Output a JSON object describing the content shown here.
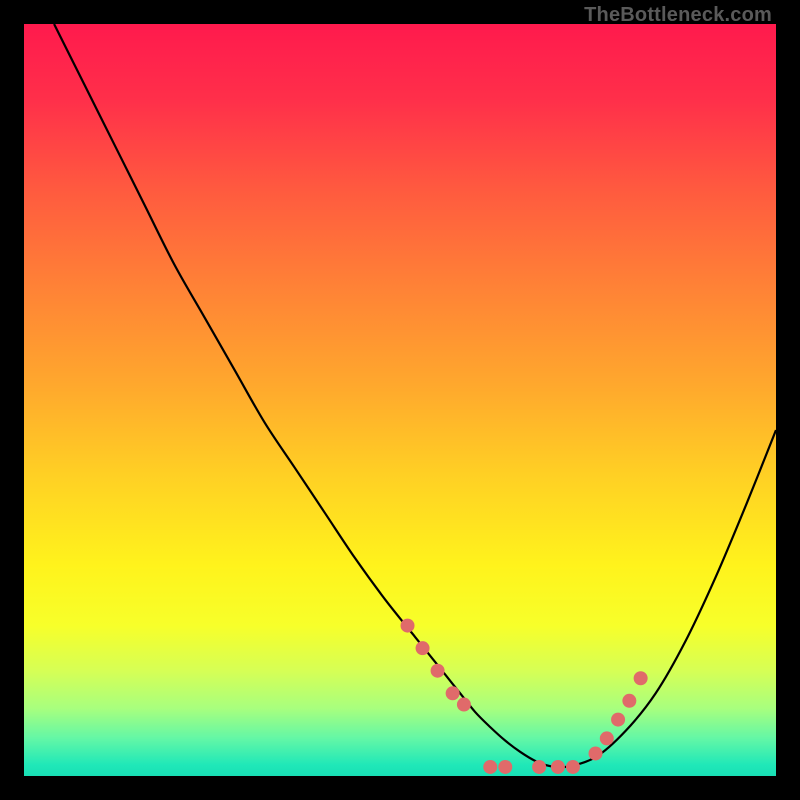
{
  "watermark": "TheBottleneck.com",
  "chart_data": {
    "type": "line",
    "title": "",
    "xlabel": "",
    "ylabel": "",
    "xlim": [
      0,
      100
    ],
    "ylim": [
      0,
      100
    ],
    "series": [
      {
        "name": "bottleneck-curve",
        "x": [
          4,
          8,
          12,
          16,
          20,
          24,
          28,
          32,
          36,
          40,
          44,
          48,
          52,
          54,
          56,
          58,
          60,
          62,
          64,
          66,
          68,
          70,
          72,
          76,
          80,
          84,
          88,
          92,
          96,
          100
        ],
        "y": [
          100,
          92,
          84,
          76,
          68,
          61,
          54,
          47,
          41,
          35,
          29,
          23.5,
          18.5,
          16,
          13.5,
          11,
          8.5,
          6.5,
          4.7,
          3.2,
          2,
          1.3,
          1.2,
          2.5,
          6,
          11,
          18,
          26.5,
          36,
          46
        ]
      }
    ],
    "markers": {
      "name": "highlight-dots",
      "color": "#e06a6a",
      "x": [
        51,
        53,
        55,
        57,
        58.5,
        62,
        64,
        68.5,
        71,
        73,
        76,
        77.5,
        79,
        80.5,
        82
      ],
      "y": [
        20,
        17,
        14,
        11,
        9.5,
        1.2,
        1.2,
        1.2,
        1.2,
        1.2,
        3,
        5,
        7.5,
        10,
        13
      ]
    },
    "gradient_stops": [
      {
        "offset": 0.0,
        "color": "#ff1a4d"
      },
      {
        "offset": 0.1,
        "color": "#ff2f4a"
      },
      {
        "offset": 0.22,
        "color": "#ff5a3f"
      },
      {
        "offset": 0.35,
        "color": "#ff8236"
      },
      {
        "offset": 0.48,
        "color": "#ffa82d"
      },
      {
        "offset": 0.6,
        "color": "#ffd024"
      },
      {
        "offset": 0.72,
        "color": "#fff31c"
      },
      {
        "offset": 0.8,
        "color": "#f7ff2a"
      },
      {
        "offset": 0.86,
        "color": "#d6ff55"
      },
      {
        "offset": 0.91,
        "color": "#a8ff7e"
      },
      {
        "offset": 0.95,
        "color": "#63f7a6"
      },
      {
        "offset": 0.985,
        "color": "#20e8b8"
      },
      {
        "offset": 1.0,
        "color": "#18dfb5"
      }
    ]
  }
}
